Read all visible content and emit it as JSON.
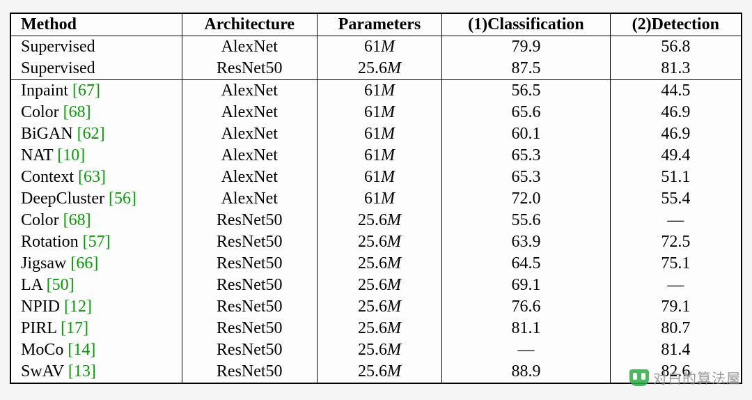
{
  "chart_data": {
    "type": "table",
    "headers": [
      "Method",
      "Architecture",
      "Parameters",
      "(1)Classification",
      "(2)Detection"
    ],
    "groups": [
      {
        "rows": [
          {
            "method": "Supervised",
            "cite": "",
            "arch": "AlexNet",
            "params_base": "61",
            "params_suffix": "M",
            "classification": "79.9",
            "detection": "56.8"
          },
          {
            "method": "Supervised",
            "cite": "",
            "arch": "ResNet50",
            "params_base": "25.6",
            "params_suffix": "M",
            "classification": "87.5",
            "detection": "81.3"
          }
        ]
      },
      {
        "rows": [
          {
            "method": "Inpaint ",
            "cite": "[67]",
            "arch": "AlexNet",
            "params_base": "61",
            "params_suffix": "M",
            "classification": "56.5",
            "detection": "44.5"
          },
          {
            "method": "Color ",
            "cite": "[68]",
            "arch": "AlexNet",
            "params_base": "61",
            "params_suffix": "M",
            "classification": "65.6",
            "detection": "46.9"
          },
          {
            "method": "BiGAN ",
            "cite": "[62]",
            "arch": "AlexNet",
            "params_base": "61",
            "params_suffix": "M",
            "classification": "60.1",
            "detection": "46.9"
          },
          {
            "method": "NAT ",
            "cite": "[10]",
            "arch": "AlexNet",
            "params_base": "61",
            "params_suffix": "M",
            "classification": "65.3",
            "detection": "49.4"
          },
          {
            "method": "Context ",
            "cite": "[63]",
            "arch": "AlexNet",
            "params_base": "61",
            "params_suffix": "M",
            "classification": "65.3",
            "detection": "51.1"
          },
          {
            "method": "DeepCluster ",
            "cite": "[56]",
            "arch": "AlexNet",
            "params_base": "61",
            "params_suffix": "M",
            "classification": "72.0",
            "detection": "55.4"
          },
          {
            "method": "Color ",
            "cite": "[68]",
            "arch": "ResNet50",
            "params_base": "25.6",
            "params_suffix": "M",
            "classification": "55.6",
            "detection": "—"
          },
          {
            "method": "Rotation ",
            "cite": "[57]",
            "arch": "ResNet50",
            "params_base": "25.6",
            "params_suffix": "M",
            "classification": "63.9",
            "detection": "72.5"
          },
          {
            "method": "Jigsaw ",
            "cite": "[66]",
            "arch": "ResNet50",
            "params_base": "25.6",
            "params_suffix": "M",
            "classification": "64.5",
            "detection": "75.1"
          },
          {
            "method": "LA ",
            "cite": "[50]",
            "arch": "ResNet50",
            "params_base": "25.6",
            "params_suffix": "M",
            "classification": "69.1",
            "detection": "—"
          },
          {
            "method": "NPID ",
            "cite": "[12]",
            "arch": "ResNet50",
            "params_base": "25.6",
            "params_suffix": "M",
            "classification": "76.6",
            "detection": "79.1"
          },
          {
            "method": "PIRL ",
            "cite": "[17]",
            "arch": "ResNet50",
            "params_base": "25.6",
            "params_suffix": "M",
            "classification": "81.1",
            "detection": "80.7"
          },
          {
            "method": "MoCo ",
            "cite": "[14]",
            "arch": "ResNet50",
            "params_base": "25.6",
            "params_suffix": "M",
            "classification": "—",
            "detection": "81.4"
          },
          {
            "method": "SwAV ",
            "cite": "[13]",
            "arch": "ResNet50",
            "params_base": "25.6",
            "params_suffix": "M",
            "classification": "88.9",
            "detection": "82.6"
          }
        ]
      }
    ]
  },
  "watermark": "对白的算法屋"
}
